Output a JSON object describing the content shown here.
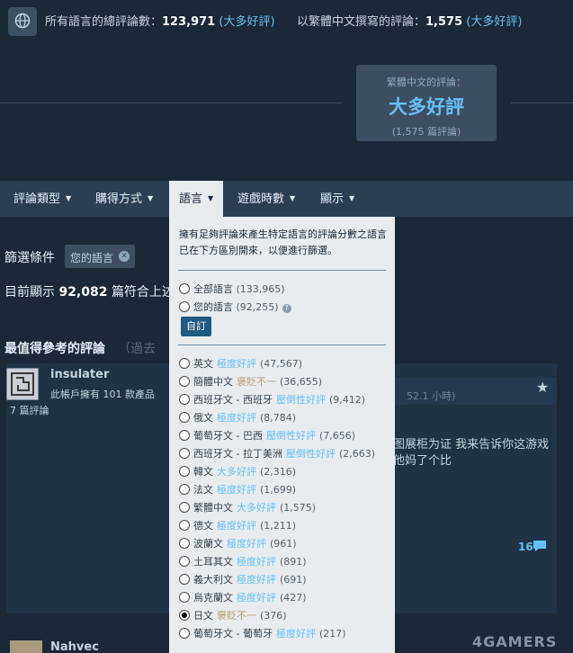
{
  "summary": {
    "all_label": "所有語言的總評論數：",
    "all_count": "123,971",
    "all_rating": "(大多好評)",
    "lang_label": "以繁體中文撰寫的評論：",
    "lang_count": "1,575",
    "lang_rating": "(大多好評)",
    "icon": "globe-icon"
  },
  "card": {
    "title": "繁體中文的評論：",
    "rating": "大多好評",
    "count": "(1,575 篇評論)"
  },
  "menu": {
    "items": [
      {
        "label": "評論類型"
      },
      {
        "label": "購得方式"
      },
      {
        "label": "語言"
      },
      {
        "label": "遊戲時數"
      },
      {
        "label": "顯示"
      }
    ]
  },
  "filters": {
    "label": "篩選條件",
    "chip": "您的語言",
    "showing_prefix": "目前顯示",
    "showing_count": "92,082",
    "showing_suffix": "篇符合上述"
  },
  "section": {
    "title": "最值得參考的評論",
    "subtitle": "（過去"
  },
  "review": {
    "user": "insulater",
    "owned": "此帳戶擁有 101 款產品",
    "reviews": "7 篇評論",
    "hours": "52.1 小時)",
    "text_line1": "图展柜为证 我来告诉你这游戏",
    "text_line2": "他妈了个比",
    "comments": "16"
  },
  "review2": {
    "user": "Nahvec"
  },
  "watermark": "4GAMERS",
  "dropdown": {
    "description": "擁有足夠評論來產生特定語言的評論分數之語言已在下方區別開來，以便進行篩選。",
    "top_options": [
      {
        "label": "全部語言",
        "count": "(133,965)"
      },
      {
        "label": "您的語言",
        "count": "(92,255)"
      }
    ],
    "help": "?",
    "custom_button": "自訂",
    "languages": [
      {
        "label": "英文",
        "rating": "極度好評",
        "count": "(47,567)",
        "kind": "pos"
      },
      {
        "label": "簡體中文",
        "rating": "褒貶不一",
        "count": "(36,655)",
        "kind": "mix"
      },
      {
        "label": "西班牙文 - 西班牙",
        "rating": "壓倒性好評",
        "count": "(9,412)",
        "kind": "pos"
      },
      {
        "label": "俄文",
        "rating": "極度好評",
        "count": "(8,784)",
        "kind": "pos"
      },
      {
        "label": "葡萄牙文 - 巴西",
        "rating": "壓倒性好評",
        "count": "(7,656)",
        "kind": "pos"
      },
      {
        "label": "西班牙文 - 拉丁美洲",
        "rating": "壓倒性好評",
        "count": "(2,663)",
        "kind": "pos"
      },
      {
        "label": "韓文",
        "rating": "大多好評",
        "count": "(2,316)",
        "kind": "pos"
      },
      {
        "label": "法文",
        "rating": "極度好評",
        "count": "(1,699)",
        "kind": "pos"
      },
      {
        "label": "繁體中文",
        "rating": "大多好評",
        "count": "(1,575)",
        "kind": "pos"
      },
      {
        "label": "德文",
        "rating": "極度好評",
        "count": "(1,211)",
        "kind": "pos"
      },
      {
        "label": "波蘭文",
        "rating": "極度好評",
        "count": "(961)",
        "kind": "pos"
      },
      {
        "label": "土耳其文",
        "rating": "極度好評",
        "count": "(891)",
        "kind": "pos"
      },
      {
        "label": "義大利文",
        "rating": "極度好評",
        "count": "(691)",
        "kind": "pos"
      },
      {
        "label": "烏克蘭文",
        "rating": "極度好評",
        "count": "(427)",
        "kind": "pos"
      },
      {
        "label": "日文",
        "rating": "褒貶不一",
        "count": "(376)",
        "kind": "mix",
        "selected": true
      },
      {
        "label": "葡萄牙文 - 葡萄牙",
        "rating": "極度好評",
        "count": "(217)",
        "kind": "pos"
      }
    ]
  }
}
